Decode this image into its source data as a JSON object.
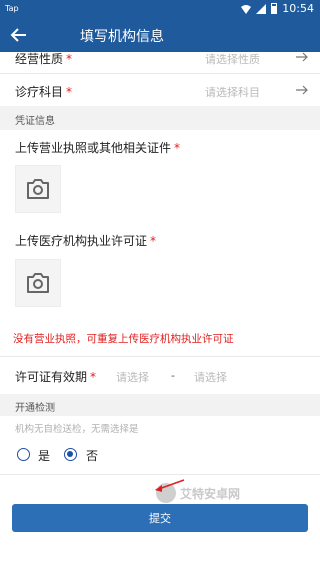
{
  "status_bar": {
    "left_text": "Tap",
    "time": "10:54"
  },
  "app_bar": {
    "title": "填写机构信息"
  },
  "form": {
    "business_nature": {
      "label": "经营性质",
      "required": "*",
      "placeholder": "请选择性质"
    },
    "department": {
      "label": "诊疗科目",
      "required": "*",
      "placeholder": "请选择科目"
    },
    "credentials_section": "凭证信息",
    "business_license": {
      "label": "上传营业执照或其他相关证件",
      "required": "*"
    },
    "medical_license": {
      "label": "上传医疗机构执业许可证",
      "required": "*"
    },
    "warning": "没有营业执照，可重复上传医疗机构执业许可证",
    "validity": {
      "label": "许可证有效期",
      "required": "*",
      "start_placeholder": "请选择",
      "separator": "-",
      "end_placeholder": "请选择"
    },
    "testing_section": "开通检测",
    "testing_hint": "机构无自检送检，无需选择是",
    "testing_options": [
      {
        "label": "是",
        "selected": false
      },
      {
        "label": "否",
        "selected": true
      }
    ]
  },
  "submit_label": "提交",
  "watermark": {
    "text": "艾特安卓网"
  },
  "colors": {
    "primary": "#1e5a9c",
    "button": "#2d6fb7",
    "required": "#e02020",
    "radio": "#1e4fa8"
  }
}
